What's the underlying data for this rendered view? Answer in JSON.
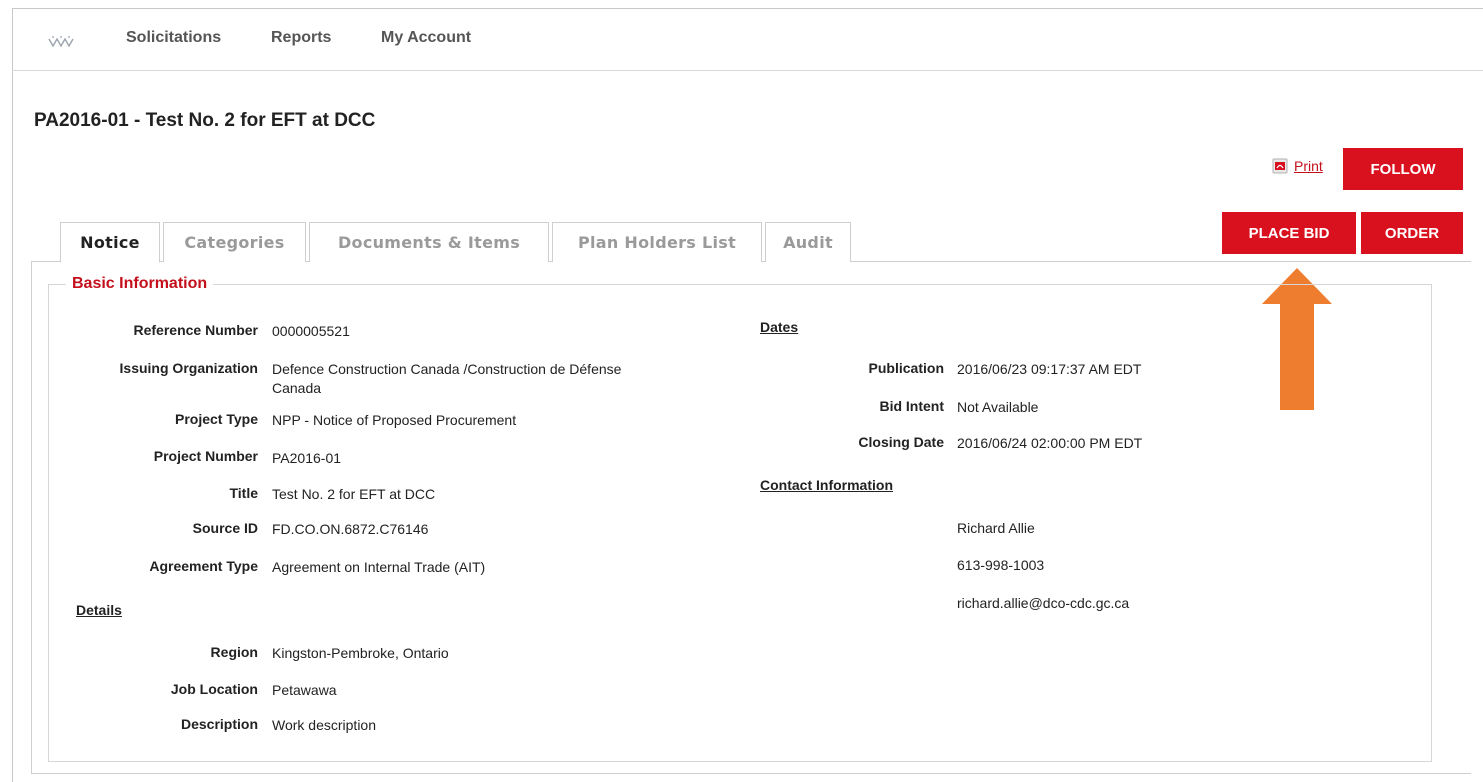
{
  "nav": {
    "items": [
      "Solicitations",
      "Reports",
      "My Account"
    ]
  },
  "page": {
    "title": "PA2016-01 - Test No. 2 for EFT at DCC"
  },
  "actions": {
    "print_label": "Print",
    "follow_label": "FOLLOW",
    "place_bid_label": "PLACE BID",
    "order_label": "ORDER"
  },
  "tabs": [
    {
      "label": "Notice",
      "active": true
    },
    {
      "label": "Categories",
      "active": false
    },
    {
      "label": "Documents & Items",
      "active": false
    },
    {
      "label": "Plan Holders List",
      "active": false
    },
    {
      "label": "Audit",
      "active": false
    }
  ],
  "basic_info": {
    "legend": "Basic Information",
    "fields": [
      {
        "label": "Reference Number",
        "value": "0000005521"
      },
      {
        "label": "Issuing Organization",
        "value": "Defence Construction Canada /Construction de Défense",
        "value2": "Canada"
      },
      {
        "label": "Project Type",
        "value": "NPP - Notice of Proposed Procurement"
      },
      {
        "label": "Project Number",
        "value": "PA2016-01"
      },
      {
        "label": "Title",
        "value": "Test No. 2 for EFT at DCC"
      },
      {
        "label": "Source ID",
        "value": "FD.CO.ON.6872.C76146"
      },
      {
        "label": "Agreement Type",
        "value": "Agreement on Internal Trade (AIT)"
      }
    ],
    "details_heading": "Details",
    "details": [
      {
        "label": "Region",
        "value": "Kingston-Pembroke, Ontario"
      },
      {
        "label": "Job Location",
        "value": "Petawawa"
      },
      {
        "label": "Description",
        "value": "Work description"
      }
    ],
    "dates_heading": "Dates",
    "dates": [
      {
        "label": "Publication",
        "value": "2016/06/23 09:17:37 AM EDT"
      },
      {
        "label": "Bid Intent",
        "value": "Not Available"
      },
      {
        "label": "Closing Date",
        "value": "2016/06/24 02:00:00 PM EDT"
      }
    ],
    "contact_heading": "Contact Information",
    "contact": {
      "name": "Richard Allie",
      "phone": "613-998-1003",
      "email": "richard.allie@dco-cdc.gc.ca"
    }
  },
  "colors": {
    "accent_red": "#d9101d",
    "arrow_orange": "#ef7d2f"
  }
}
